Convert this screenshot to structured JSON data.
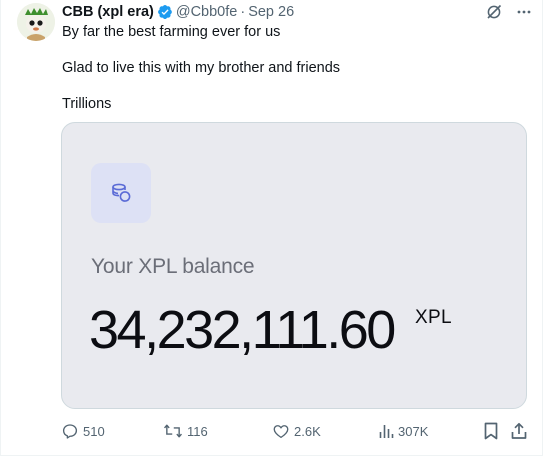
{
  "author": {
    "display_name": "CBB (xpl era)",
    "handle": "@Cbb0fe",
    "separator": "·",
    "date": "Sep 26",
    "verified": true
  },
  "tweet_text": {
    "line1": "By far the best farming ever for us",
    "line2": "Glad to live this with my brother and friends",
    "line3": "Trillions"
  },
  "media": {
    "label": "Your XPL balance",
    "balance": "34,232,111.60",
    "unit": "XPL",
    "icon": "coins-icon"
  },
  "actions": {
    "replies": "510",
    "reposts": "116",
    "likes": "2.6K",
    "views": "307K"
  },
  "colors": {
    "verified": "#1d9bf0",
    "secondary_text": "#536471",
    "media_bg": "#e9eaef",
    "coin_tile": "#dde1f5",
    "coin_icon": "#5b6bd6"
  },
  "icons": [
    "grok-icon",
    "more-icon",
    "reply-icon",
    "repost-icon",
    "like-icon",
    "views-icon",
    "bookmark-icon",
    "share-icon"
  ]
}
